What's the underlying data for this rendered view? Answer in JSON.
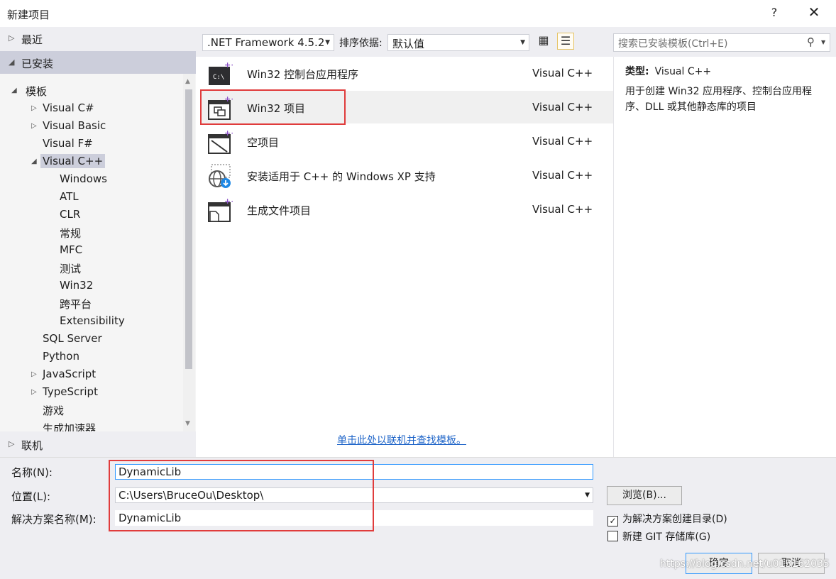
{
  "window": {
    "title": "新建项目",
    "help": "?",
    "close": "✕"
  },
  "nav": {
    "recent": "最近",
    "installed": "已安装",
    "online": "联机"
  },
  "tree": {
    "root": "模板",
    "items": [
      "Visual C#",
      "Visual Basic",
      "Visual F#",
      "Visual C++",
      "Windows",
      "ATL",
      "CLR",
      "常规",
      "MFC",
      "测试",
      "Win32",
      "跨平台",
      "Extensibility",
      "SQL Server",
      "Python",
      "JavaScript",
      "TypeScript",
      "游戏",
      "生成加速器"
    ],
    "selected": "Visual C++"
  },
  "toolbar": {
    "framework": ".NET Framework 4.5.2",
    "sort_label": "排序依据:",
    "sort_value": "默认值",
    "search_placeholder": "搜索已安装模板(Ctrl+E)"
  },
  "templates": [
    {
      "name": "Win32 控制台应用程序",
      "lang": "Visual C++"
    },
    {
      "name": "Win32 项目",
      "lang": "Visual C++",
      "selected": true
    },
    {
      "name": "空项目",
      "lang": "Visual C++"
    },
    {
      "name": "安装适用于 C++ 的 Windows XP 支持",
      "lang": "Visual C++"
    },
    {
      "name": "生成文件项目",
      "lang": "Visual C++"
    }
  ],
  "online_link": "单击此处以联机并查找模板。",
  "details": {
    "type_label": "类型:",
    "type_value": "Visual C++",
    "description": "用于创建 Win32 应用程序、控制台应用程序、DLL 或其他静态库的项目"
  },
  "form": {
    "name_label": "名称(N):",
    "name_value": "DynamicLib",
    "location_label": "位置(L):",
    "location_value": "C:\\Users\\BruceOu\\Desktop\\",
    "solution_label": "解决方案名称(M):",
    "solution_value": "DynamicLib",
    "browse": "浏览(B)...",
    "create_dir": "为解决方案创建目录(D)",
    "create_dir_checked": true,
    "git_repo": "新建 GIT 存储库(G)",
    "git_repo_checked": false,
    "ok": "确定",
    "cancel": "取消"
  },
  "watermark": "https://blog.csdn.net/u013162035",
  "colors": {
    "highlight": "#e03c3c",
    "link": "#1e64c8",
    "selection": "#cccedb"
  }
}
